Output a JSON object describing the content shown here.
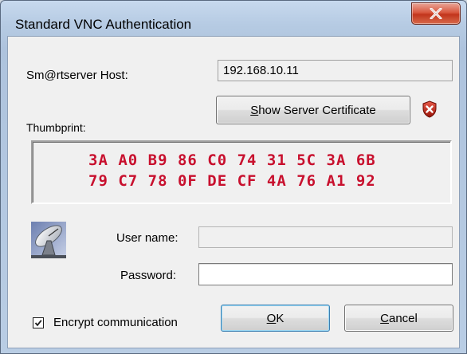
{
  "window": {
    "title": "Standard VNC Authentication"
  },
  "host": {
    "label": "Sm@rtserver Host:",
    "value": "192.168.10.11"
  },
  "certificate": {
    "button_label_prefix": "",
    "button_label_mnemonic": "S",
    "button_label_rest": "how Server Certificate",
    "status_icon": "shield-error-icon"
  },
  "thumbprint": {
    "label": "Thumbprint:",
    "line1": "3A A0 B9 86 C0 74 31 5C 3A 6B",
    "line2": "79 C7 78 0F DE CF 4A 76 A1 92",
    "color": "#c8102e"
  },
  "credentials": {
    "icon": "satellite-dish-icon",
    "username_label": "User name:",
    "username_value": "",
    "password_label": "Password:",
    "password_value": ""
  },
  "options": {
    "encrypt_label": "Encrypt communication",
    "encrypt_checked": true
  },
  "buttons": {
    "ok_mnemonic": "O",
    "ok_rest": "K",
    "cancel_mnemonic": "C",
    "cancel_rest": "ancel"
  }
}
